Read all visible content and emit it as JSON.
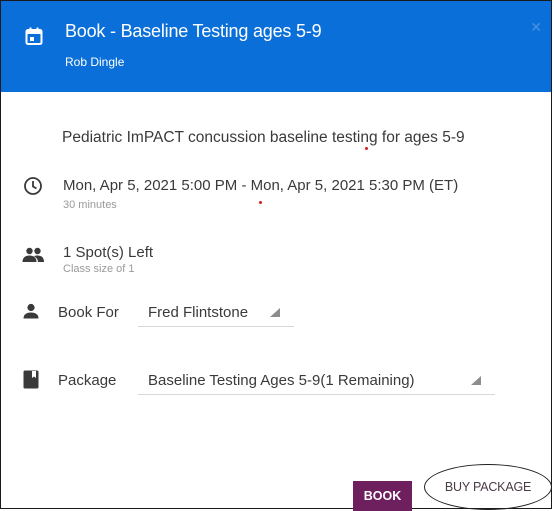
{
  "dialog": {
    "title": "Book - Baseline Testing ages 5-9",
    "subtitle": "Rob Dingle",
    "close_icon": "close-icon",
    "header_color": "#0a6fd8"
  },
  "event": {
    "description": "Pediatric ImPACT concussion baseline testing for ages 5-9",
    "datetime": "Mon, Apr 5, 2021 5:00 PM - Mon, Apr 5, 2021 5:30 PM (ET)",
    "duration": "30 minutes",
    "spots": "1 Spot(s) Left",
    "class_size": "Class size of 1"
  },
  "form": {
    "book_for_label": "Book For",
    "book_for_value": "Fred Flintstone",
    "package_label": "Package",
    "package_value": "Baseline Testing Ages 5-9(1 Remaining)"
  },
  "actions": {
    "book_label": "BOOK",
    "buy_package_label": "BUY PACKAGE",
    "book_color": "#6e1f5e"
  }
}
